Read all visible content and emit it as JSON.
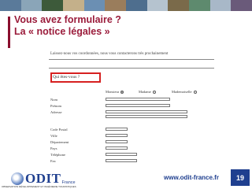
{
  "title": {
    "line1": "Vous avez formulaire ?",
    "line2": "La « notice légales »"
  },
  "form": {
    "intro": "Laissez-nous vos coordonnées, nous vous contacterons très prochainement",
    "question": "Qui êtes-vous ?",
    "civility": [
      {
        "label": "Monsieur",
        "checked": true
      },
      {
        "label": "Madame",
        "checked": false
      },
      {
        "label": "Mademoiselle",
        "checked": false
      }
    ],
    "fields": [
      "Nom",
      "Prénom",
      "Adresse",
      "Code Postal",
      "Ville",
      "Département",
      "Pays",
      "Téléphone",
      "Fax"
    ]
  },
  "footer": {
    "logo_text": "ODIT",
    "logo_sub": "France",
    "logo_tagline": "OBSERVATION DÉVELOPPEMENT ET INGÉNIERIE TOURISTIQUES",
    "url": "www.odit-france.fr",
    "page_number": "19"
  },
  "colors": {
    "title": "#9b1c3b",
    "accent_bar": "#8a0f2e",
    "brand_blue": "#1f3f8f",
    "highlight_red": "#d62020"
  }
}
